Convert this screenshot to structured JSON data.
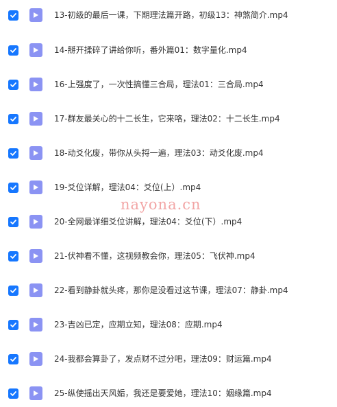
{
  "files": [
    {
      "name": "13-初级的最后一课，下期理法篇开路，初级13：神煞简介.mp4",
      "checked": true
    },
    {
      "name": "14-掰开揉碎了讲给你听，番外篇01：数字量化.mp4",
      "checked": true
    },
    {
      "name": "16-上强度了，一次性搞懂三合局，理法01：三合局.mp4",
      "checked": true
    },
    {
      "name": "17-群友最关心的十二长生，它来咯，理法02：十二长生.mp4",
      "checked": true
    },
    {
      "name": "18-动爻化废，带你从头捋一遍，理法03：动爻化废.mp4",
      "checked": true
    },
    {
      "name": "19-爻位详解，理法04：爻位(上）.mp4",
      "checked": true
    },
    {
      "name": "20-全网最详细爻位讲解，理法04：爻位(下）.mp4",
      "checked": true
    },
    {
      "name": "21-伏神看不懂，这视频教会你，理法05：飞伏神.mp4",
      "checked": true
    },
    {
      "name": "22-看到静卦就头疼，那你是没看过这节课，理法07：静卦.mp4",
      "checked": true
    },
    {
      "name": "23-吉凶已定，应期立知，理法08：应期.mp4",
      "checked": true
    },
    {
      "name": "24-我都会算卦了，发点财不过分吧，理法09：财运篇.mp4",
      "checked": true
    },
    {
      "name": "25-纵使摇出天风姤，我还是要爱她，理法10：姻缘篇.mp4",
      "checked": true
    }
  ],
  "watermark": "nayona.cn",
  "colors": {
    "checkbox": "#1677ff",
    "file_icon": "#8b93f3",
    "text": "#333333"
  },
  "icons": {
    "checkbox": "checkmark-icon",
    "file": "video-file-icon"
  }
}
